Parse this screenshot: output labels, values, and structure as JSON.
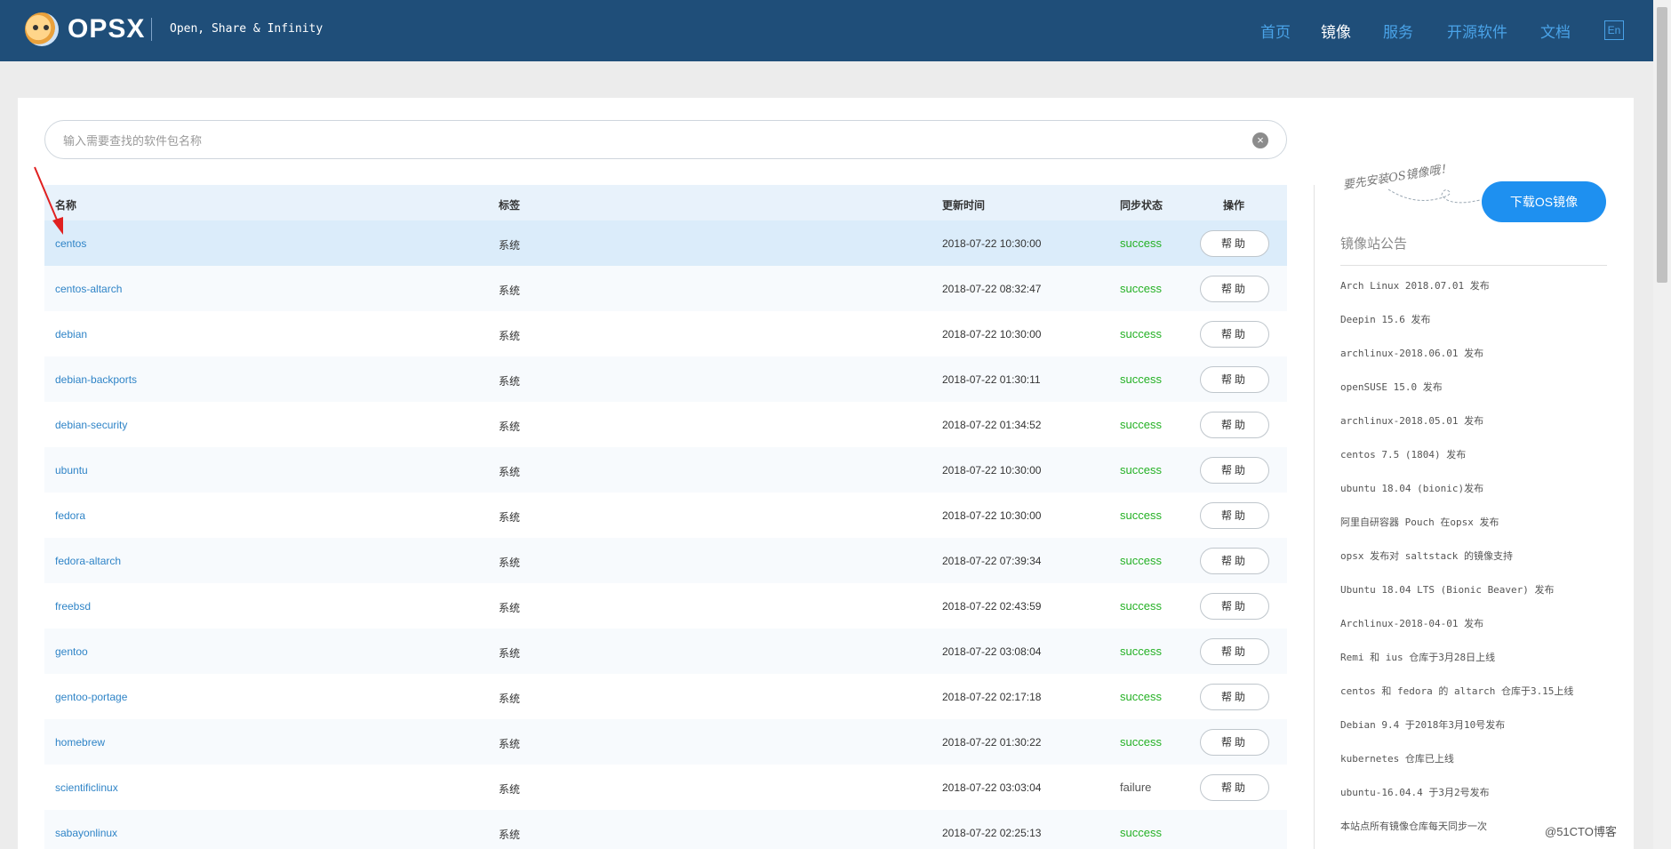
{
  "header": {
    "brand": "OPSX",
    "tagline": "Open, Share & Infinity",
    "nav": [
      {
        "label": "首页",
        "active": false
      },
      {
        "label": "镜像",
        "active": true
      },
      {
        "label": "服务",
        "active": false
      },
      {
        "label": "开源软件",
        "active": false
      },
      {
        "label": "文档",
        "active": false
      }
    ],
    "lang_label": "En"
  },
  "search": {
    "placeholder": "输入需要查找的软件包名称",
    "clear_glyph": "×"
  },
  "table": {
    "headers": {
      "name": "名称",
      "tag": "标签",
      "time": "更新时间",
      "status": "同步状态",
      "action": "操作"
    },
    "rows": [
      {
        "name": "centos",
        "tag": "系统",
        "time": "2018-07-22 10:30:00",
        "status": "success",
        "action": "帮助"
      },
      {
        "name": "centos-altarch",
        "tag": "系统",
        "time": "2018-07-22 08:32:47",
        "status": "success",
        "action": "帮助"
      },
      {
        "name": "debian",
        "tag": "系统",
        "time": "2018-07-22 10:30:00",
        "status": "success",
        "action": "帮助"
      },
      {
        "name": "debian-backports",
        "tag": "系统",
        "time": "2018-07-22 01:30:11",
        "status": "success",
        "action": "帮助"
      },
      {
        "name": "debian-security",
        "tag": "系统",
        "time": "2018-07-22 01:34:52",
        "status": "success",
        "action": "帮助"
      },
      {
        "name": "ubuntu",
        "tag": "系统",
        "time": "2018-07-22 10:30:00",
        "status": "success",
        "action": "帮助"
      },
      {
        "name": "fedora",
        "tag": "系统",
        "time": "2018-07-22 10:30:00",
        "status": "success",
        "action": "帮助"
      },
      {
        "name": "fedora-altarch",
        "tag": "系统",
        "time": "2018-07-22 07:39:34",
        "status": "success",
        "action": "帮助"
      },
      {
        "name": "freebsd",
        "tag": "系统",
        "time": "2018-07-22 02:43:59",
        "status": "success",
        "action": "帮助"
      },
      {
        "name": "gentoo",
        "tag": "系统",
        "time": "2018-07-22 03:08:04",
        "status": "success",
        "action": "帮助"
      },
      {
        "name": "gentoo-portage",
        "tag": "系统",
        "time": "2018-07-22 02:17:18",
        "status": "success",
        "action": "帮助"
      },
      {
        "name": "homebrew",
        "tag": "系统",
        "time": "2018-07-22 01:30:22",
        "status": "success",
        "action": "帮助"
      },
      {
        "name": "scientificlinux",
        "tag": "系统",
        "time": "2018-07-22 03:03:04",
        "status": "failure",
        "action": "帮助"
      },
      {
        "name": "sabayonlinux",
        "tag": "系统",
        "time": "2018-07-22 02:25:13",
        "status": "success",
        "action": ""
      }
    ]
  },
  "sidebar": {
    "install_note": "要先安装OS镜像哦！",
    "download_label": "下载OS镜像",
    "notice_title": "镜像站公告",
    "notices": [
      "Arch Linux 2018.07.01 发布",
      "Deepin 15.6 发布",
      "archlinux-2018.06.01 发布",
      "openSUSE 15.0 发布",
      "archlinux-2018.05.01 发布",
      "centos 7.5 (1804) 发布",
      "ubuntu 18.04 (bionic)发布",
      "阿里自研容器 Pouch 在opsx 发布",
      "opsx 发布对 saltstack 的镜像支持",
      "Ubuntu 18.04 LTS (Bionic Beaver) 发布",
      "Archlinux-2018-04-01 发布",
      "Remi 和 ius 仓库于3月28日上线",
      "centos 和 fedora 的 altarch 仓库于3.15上线",
      "Debian 9.4 于2018年3月10号发布",
      "kubernetes 仓库已上线",
      "ubuntu-16.04.4 于3月2号发布",
      "本站点所有镜像仓库每天同步一次"
    ]
  },
  "watermark": "@51CTO博客",
  "colors": {
    "header_bg": "#1f4e79",
    "nav_link": "#4aa3e8",
    "link": "#2f84c7",
    "success": "#25b125",
    "button_primary": "#1e90f0",
    "arrow": "#e02020"
  }
}
